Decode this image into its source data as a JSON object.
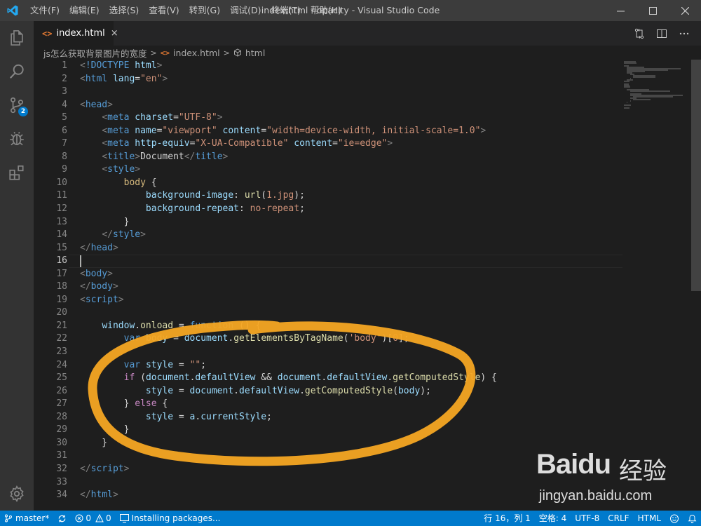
{
  "titlebar": {
    "menu": [
      "文件(F)",
      "编辑(E)",
      "选择(S)",
      "查看(V)",
      "转到(G)",
      "调试(D)",
      "终端(T)",
      "帮助(H)"
    ],
    "title": "index.html - opacity - Visual Studio Code",
    "controls": [
      "minimize",
      "maximize",
      "close"
    ]
  },
  "activitybar": {
    "items": [
      "explorer-icon",
      "search-icon",
      "source-control-icon",
      "debug-icon",
      "extensions-icon"
    ],
    "scm_badge": "2",
    "bottom": "settings-gear-icon"
  },
  "tab": {
    "label": "index.html",
    "icon": "html-file-icon",
    "close": "×"
  },
  "editor_actions": [
    "open-changes-icon",
    "split-editor-icon",
    "more-actions-icon"
  ],
  "breadcrumb": {
    "folder": "js怎么获取背景图片的宽度",
    "file": "index.html",
    "symbol": "html"
  },
  "code": {
    "line_numbers": [
      "1",
      "2",
      "3",
      "4",
      "5",
      "6",
      "7",
      "8",
      "9",
      "10",
      "11",
      "12",
      "13",
      "14",
      "15",
      "16",
      "17",
      "18",
      "19",
      "20",
      "21",
      "22",
      "23",
      "24",
      "25",
      "26",
      "27",
      "28",
      "29",
      "30",
      "31",
      "32",
      "33",
      "34"
    ],
    "current_line": 16
  },
  "watermark": {
    "brand": "Bai",
    "paw": "du",
    "cn": "经验",
    "url": "jingyan.baidu.com"
  },
  "statusbar": {
    "branch": "master*",
    "errors": "0",
    "warnings": "0",
    "task": "Installing packages...",
    "position": "行 16，列 1",
    "spaces": "空格: 4",
    "encoding": "UTF-8",
    "eol": "CRLF",
    "language": "HTML"
  }
}
